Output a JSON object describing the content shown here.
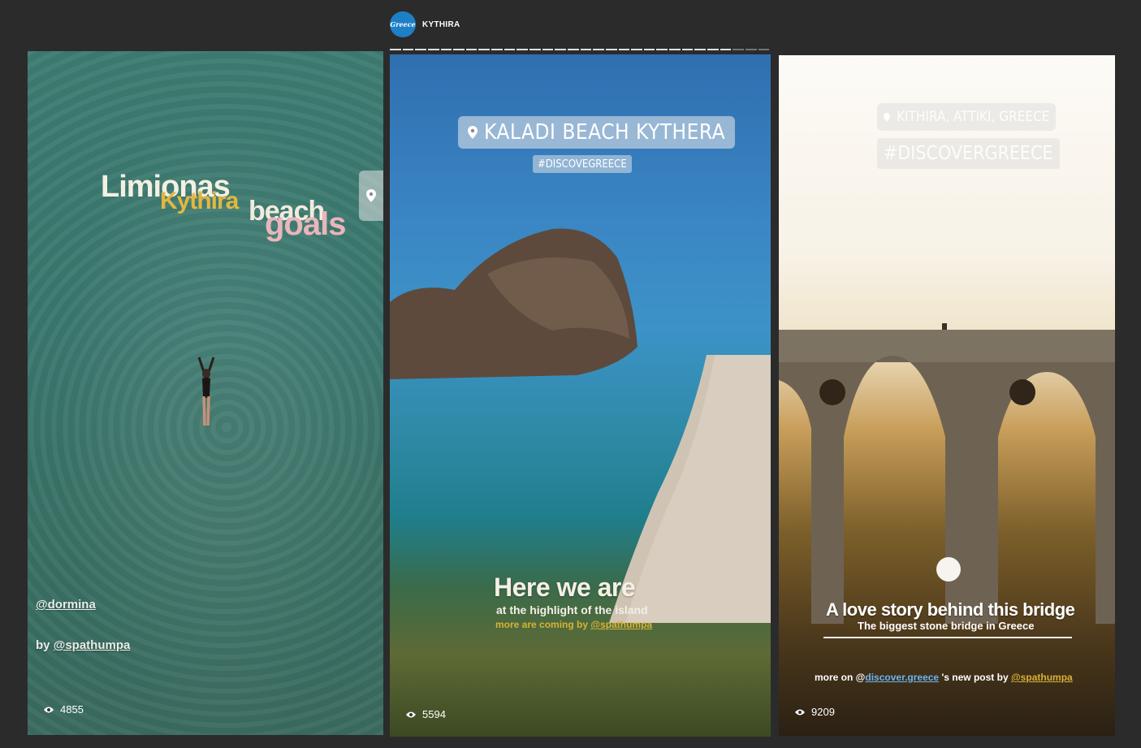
{
  "header": {
    "avatar_text": "Greece",
    "account_name": "KYTHIRA"
  },
  "stories": {
    "left": {
      "sticker_words": [
        "Limionas",
        "Kythira",
        "beach",
        "goals"
      ],
      "mention": "@dormina",
      "credit_prefix": "by ",
      "credit_handle": "@spathumpa",
      "views": "4855"
    },
    "middle": {
      "location": "KALADI BEACH KYTHERA",
      "hashtag": "#DISCOVEGREECE",
      "title": "Here we are",
      "subtitle": "at the highlight of the island",
      "more_prefix": "more are coming by ",
      "more_handle": "@spathumpa",
      "views": "5594"
    },
    "right": {
      "location": "KITHIRA, ATTIKI, GREECE",
      "hashtag": "#DISCOVERGREECE",
      "title": "A love story behind this bridge",
      "subtitle": "The biggest stone bridge in Greece",
      "more_prefix": "more on @",
      "more_link": "discover.greece",
      "more_middle": " 's new post by ",
      "more_handle": "@spathumpa",
      "views": "9209"
    }
  },
  "colors": {
    "background": "#2b2b2b",
    "accent_yellow": "#d8b234",
    "link_blue": "#6db4f0"
  }
}
